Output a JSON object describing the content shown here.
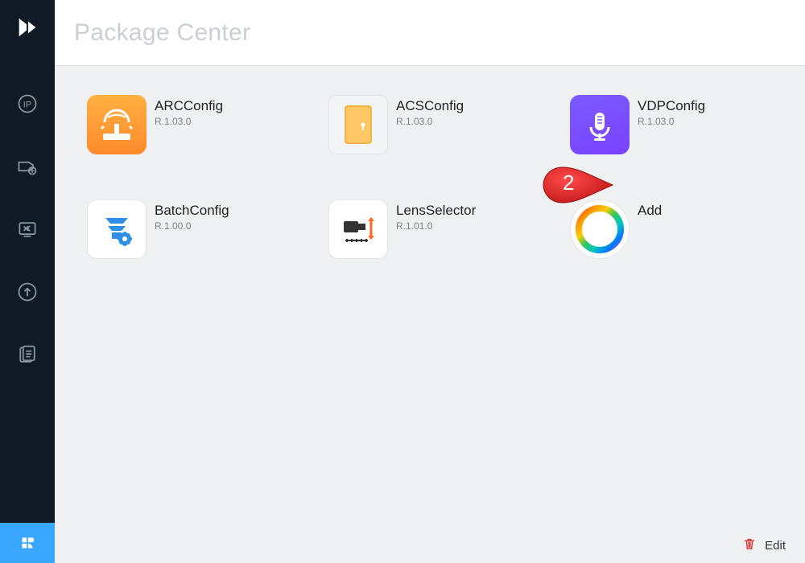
{
  "window": {
    "title": "Package Center"
  },
  "packages": [
    {
      "title": "ARCConfig",
      "version": "R.1.03.0"
    },
    {
      "title": "ACSConfig",
      "version": "R.1.03.0"
    },
    {
      "title": "VDPConfig",
      "version": "R.1.03.0"
    },
    {
      "title": "BatchConfig",
      "version": "R.1.00.0"
    },
    {
      "title": "LensSelector",
      "version": "R.1.01.0"
    },
    {
      "title": "Add",
      "version": ""
    }
  ],
  "annotation": {
    "number": "2"
  },
  "bottombar": {
    "edit": "Edit"
  }
}
